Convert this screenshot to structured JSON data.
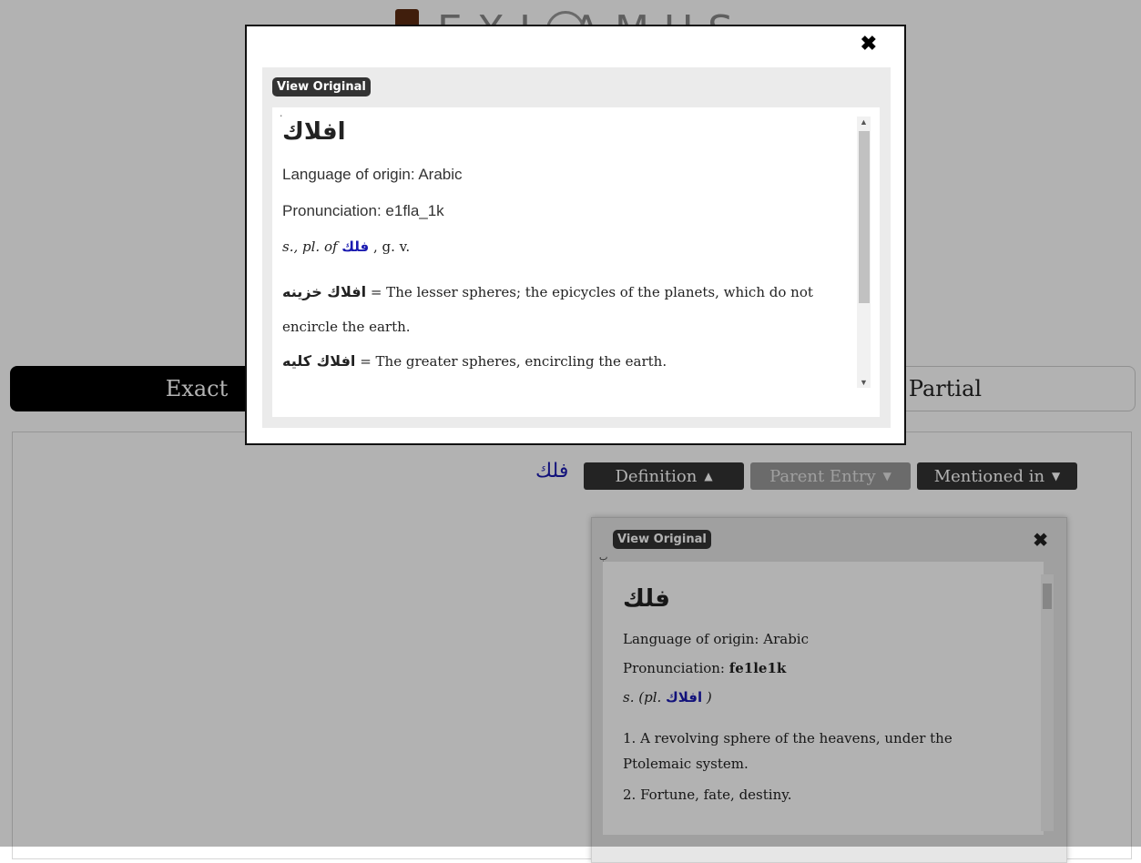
{
  "logo": {
    "text": "EXI AMUS"
  },
  "tabs": {
    "exact": "Exact",
    "partial": "Partial"
  },
  "result": {
    "word": "فلك",
    "buttons": {
      "definition": "Definition",
      "parent_entry": "Parent Entry",
      "mentioned_in": "Mentioned in"
    }
  },
  "card": {
    "view_original": "View Original",
    "close": "✖",
    "headword": "فلك",
    "origin": "Language of origin: Arabic",
    "pronunciation_label": "Pronunciation: ",
    "pronunciation_value": "fe1le1k",
    "pos_prefix": "s. (pl. ",
    "pos_link": "افلاك",
    "pos_suffix": " )",
    "senses": [
      "1. A revolving sphere of the heavens, under the Ptolemaic system.",
      "2. Fortune, fate, destiny."
    ]
  },
  "modal": {
    "close": "✖",
    "view_original": "View Original",
    "mark": "٠",
    "headword": "افلاك",
    "origin": "Language of origin: Arabic",
    "pronunciation": "Pronunciation: e1fla_1k",
    "pos_prefix": "s., pl. of ",
    "pos_link": "فلك",
    "pos_suffix": " , g. v.",
    "senses": [
      {
        "arabic": "افلاك خزينه",
        "text": " = The lesser spheres; the epicycles of the planets, which do not encircle the earth."
      },
      {
        "arabic": "افلاك كليه",
        "text": " = The greater spheres, encircling the earth."
      }
    ]
  }
}
